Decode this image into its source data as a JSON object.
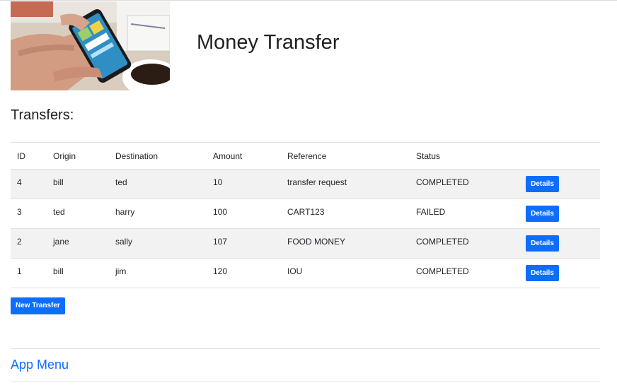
{
  "header": {
    "title": "Money Transfer",
    "hero_image": "phone-payment-photo"
  },
  "transfers": {
    "heading": "Transfers:",
    "columns": [
      "ID",
      "Origin",
      "Destination",
      "Amount",
      "Reference",
      "Status",
      ""
    ],
    "rows": [
      {
        "id": "4",
        "origin": "bill",
        "destination": "ted",
        "amount": "10",
        "reference": "transfer request",
        "status": "COMPLETED",
        "action": "Details"
      },
      {
        "id": "3",
        "origin": "ted",
        "destination": "harry",
        "amount": "100",
        "reference": "CART123",
        "status": "FAILED",
        "action": "Details"
      },
      {
        "id": "2",
        "origin": "jane",
        "destination": "sally",
        "amount": "107",
        "reference": "FOOD MONEY",
        "status": "COMPLETED",
        "action": "Details"
      },
      {
        "id": "1",
        "origin": "bill",
        "destination": "jim",
        "amount": "120",
        "reference": "IOU",
        "status": "COMPLETED",
        "action": "Details"
      }
    ],
    "new_button": "New Transfer"
  },
  "menu": {
    "link": "App Menu"
  },
  "colors": {
    "primary": "#0d6efd",
    "stripe": "#f2f2f2",
    "border": "#dee2e6"
  }
}
